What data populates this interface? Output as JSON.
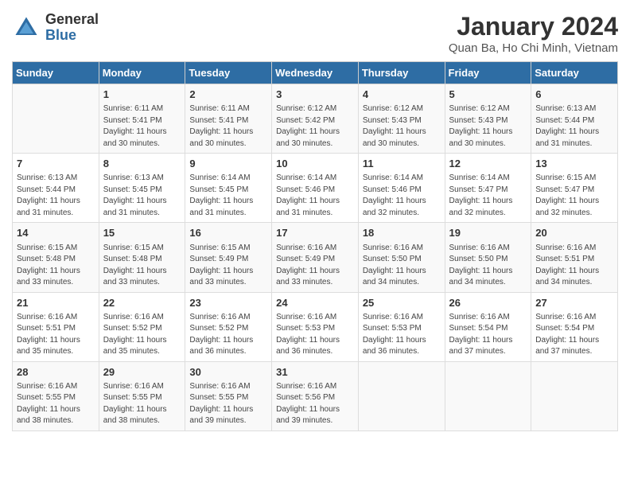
{
  "logo": {
    "general": "General",
    "blue": "Blue"
  },
  "header": {
    "title": "January 2024",
    "subtitle": "Quan Ba, Ho Chi Minh, Vietnam"
  },
  "columns": [
    "Sunday",
    "Monday",
    "Tuesday",
    "Wednesday",
    "Thursday",
    "Friday",
    "Saturday"
  ],
  "weeks": [
    [
      {
        "num": "",
        "sunrise": "",
        "sunset": "",
        "daylight": ""
      },
      {
        "num": "1",
        "sunrise": "Sunrise: 6:11 AM",
        "sunset": "Sunset: 5:41 PM",
        "daylight": "Daylight: 11 hours and 30 minutes."
      },
      {
        "num": "2",
        "sunrise": "Sunrise: 6:11 AM",
        "sunset": "Sunset: 5:41 PM",
        "daylight": "Daylight: 11 hours and 30 minutes."
      },
      {
        "num": "3",
        "sunrise": "Sunrise: 6:12 AM",
        "sunset": "Sunset: 5:42 PM",
        "daylight": "Daylight: 11 hours and 30 minutes."
      },
      {
        "num": "4",
        "sunrise": "Sunrise: 6:12 AM",
        "sunset": "Sunset: 5:43 PM",
        "daylight": "Daylight: 11 hours and 30 minutes."
      },
      {
        "num": "5",
        "sunrise": "Sunrise: 6:12 AM",
        "sunset": "Sunset: 5:43 PM",
        "daylight": "Daylight: 11 hours and 30 minutes."
      },
      {
        "num": "6",
        "sunrise": "Sunrise: 6:13 AM",
        "sunset": "Sunset: 5:44 PM",
        "daylight": "Daylight: 11 hours and 31 minutes."
      }
    ],
    [
      {
        "num": "7",
        "sunrise": "Sunrise: 6:13 AM",
        "sunset": "Sunset: 5:44 PM",
        "daylight": "Daylight: 11 hours and 31 minutes."
      },
      {
        "num": "8",
        "sunrise": "Sunrise: 6:13 AM",
        "sunset": "Sunset: 5:45 PM",
        "daylight": "Daylight: 11 hours and 31 minutes."
      },
      {
        "num": "9",
        "sunrise": "Sunrise: 6:14 AM",
        "sunset": "Sunset: 5:45 PM",
        "daylight": "Daylight: 11 hours and 31 minutes."
      },
      {
        "num": "10",
        "sunrise": "Sunrise: 6:14 AM",
        "sunset": "Sunset: 5:46 PM",
        "daylight": "Daylight: 11 hours and 31 minutes."
      },
      {
        "num": "11",
        "sunrise": "Sunrise: 6:14 AM",
        "sunset": "Sunset: 5:46 PM",
        "daylight": "Daylight: 11 hours and 32 minutes."
      },
      {
        "num": "12",
        "sunrise": "Sunrise: 6:14 AM",
        "sunset": "Sunset: 5:47 PM",
        "daylight": "Daylight: 11 hours and 32 minutes."
      },
      {
        "num": "13",
        "sunrise": "Sunrise: 6:15 AM",
        "sunset": "Sunset: 5:47 PM",
        "daylight": "Daylight: 11 hours and 32 minutes."
      }
    ],
    [
      {
        "num": "14",
        "sunrise": "Sunrise: 6:15 AM",
        "sunset": "Sunset: 5:48 PM",
        "daylight": "Daylight: 11 hours and 33 minutes."
      },
      {
        "num": "15",
        "sunrise": "Sunrise: 6:15 AM",
        "sunset": "Sunset: 5:48 PM",
        "daylight": "Daylight: 11 hours and 33 minutes."
      },
      {
        "num": "16",
        "sunrise": "Sunrise: 6:15 AM",
        "sunset": "Sunset: 5:49 PM",
        "daylight": "Daylight: 11 hours and 33 minutes."
      },
      {
        "num": "17",
        "sunrise": "Sunrise: 6:16 AM",
        "sunset": "Sunset: 5:49 PM",
        "daylight": "Daylight: 11 hours and 33 minutes."
      },
      {
        "num": "18",
        "sunrise": "Sunrise: 6:16 AM",
        "sunset": "Sunset: 5:50 PM",
        "daylight": "Daylight: 11 hours and 34 minutes."
      },
      {
        "num": "19",
        "sunrise": "Sunrise: 6:16 AM",
        "sunset": "Sunset: 5:50 PM",
        "daylight": "Daylight: 11 hours and 34 minutes."
      },
      {
        "num": "20",
        "sunrise": "Sunrise: 6:16 AM",
        "sunset": "Sunset: 5:51 PM",
        "daylight": "Daylight: 11 hours and 34 minutes."
      }
    ],
    [
      {
        "num": "21",
        "sunrise": "Sunrise: 6:16 AM",
        "sunset": "Sunset: 5:51 PM",
        "daylight": "Daylight: 11 hours and 35 minutes."
      },
      {
        "num": "22",
        "sunrise": "Sunrise: 6:16 AM",
        "sunset": "Sunset: 5:52 PM",
        "daylight": "Daylight: 11 hours and 35 minutes."
      },
      {
        "num": "23",
        "sunrise": "Sunrise: 6:16 AM",
        "sunset": "Sunset: 5:52 PM",
        "daylight": "Daylight: 11 hours and 36 minutes."
      },
      {
        "num": "24",
        "sunrise": "Sunrise: 6:16 AM",
        "sunset": "Sunset: 5:53 PM",
        "daylight": "Daylight: 11 hours and 36 minutes."
      },
      {
        "num": "25",
        "sunrise": "Sunrise: 6:16 AM",
        "sunset": "Sunset: 5:53 PM",
        "daylight": "Daylight: 11 hours and 36 minutes."
      },
      {
        "num": "26",
        "sunrise": "Sunrise: 6:16 AM",
        "sunset": "Sunset: 5:54 PM",
        "daylight": "Daylight: 11 hours and 37 minutes."
      },
      {
        "num": "27",
        "sunrise": "Sunrise: 6:16 AM",
        "sunset": "Sunset: 5:54 PM",
        "daylight": "Daylight: 11 hours and 37 minutes."
      }
    ],
    [
      {
        "num": "28",
        "sunrise": "Sunrise: 6:16 AM",
        "sunset": "Sunset: 5:55 PM",
        "daylight": "Daylight: 11 hours and 38 minutes."
      },
      {
        "num": "29",
        "sunrise": "Sunrise: 6:16 AM",
        "sunset": "Sunset: 5:55 PM",
        "daylight": "Daylight: 11 hours and 38 minutes."
      },
      {
        "num": "30",
        "sunrise": "Sunrise: 6:16 AM",
        "sunset": "Sunset: 5:55 PM",
        "daylight": "Daylight: 11 hours and 39 minutes."
      },
      {
        "num": "31",
        "sunrise": "Sunrise: 6:16 AM",
        "sunset": "Sunset: 5:56 PM",
        "daylight": "Daylight: 11 hours and 39 minutes."
      },
      {
        "num": "",
        "sunrise": "",
        "sunset": "",
        "daylight": ""
      },
      {
        "num": "",
        "sunrise": "",
        "sunset": "",
        "daylight": ""
      },
      {
        "num": "",
        "sunrise": "",
        "sunset": "",
        "daylight": ""
      }
    ]
  ]
}
